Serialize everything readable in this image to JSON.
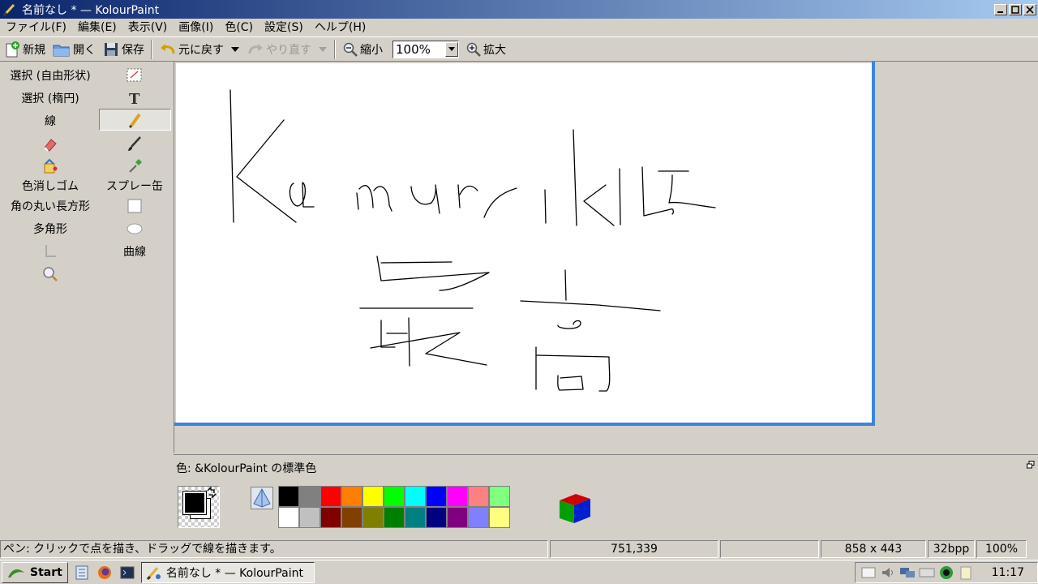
{
  "window": {
    "title": "名前なし * — KolourPaint"
  },
  "menu": [
    "ファイル(F)",
    "編集(E)",
    "表示(V)",
    "画像(I)",
    "色(C)",
    "設定(S)",
    "ヘルプ(H)"
  ],
  "toolbar": {
    "new_label": "新規",
    "open_label": "開く",
    "save_label": "保存",
    "undo_label": "元に戻す",
    "redo_label": "やり直す",
    "zoom_out_label": "縮小",
    "zoom_value": "100%",
    "zoom_in_label": "拡大"
  },
  "tools": {
    "free_select": "選択 (自由形状)",
    "ellipse_select": "選択 (楕円)",
    "line": "線",
    "color_eraser": "色消しゴム",
    "spraycan": "スプレー缶",
    "rounded_rect": "角の丸い長方形",
    "polygon": "多角形",
    "curve": "曲線"
  },
  "colorbox": {
    "title": "色: &KolourPaint の標準色",
    "palette_top": [
      "#000000",
      "#808080",
      "#ff0000",
      "#ff8000",
      "#ffff00",
      "#00ff00",
      "#00ffff",
      "#0000ff",
      "#ff00ff",
      "#ff8080",
      "#80ff80"
    ],
    "palette_bottom": [
      "#ffffff",
      "#c0c0c0",
      "#800000",
      "#804000",
      "#808000",
      "#008000",
      "#008080",
      "#000080",
      "#800080",
      "#8080ff",
      "#ffff80"
    ]
  },
  "status": {
    "message": "ペン: クリックで点を描き、ドラッグで線を描きます。",
    "cursor": "751,339",
    "selection": "",
    "size": "858 x 443",
    "depth": "32bpp",
    "zoom": "100%"
  },
  "taskbar": {
    "start_label": "Start",
    "task_label": "名前なし * — KolourPaint",
    "clock": "11:17"
  }
}
